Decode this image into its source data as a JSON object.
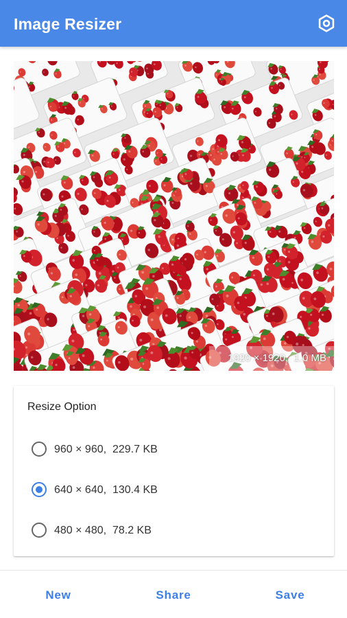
{
  "app_bar": {
    "title": "Image Resizer",
    "settings_icon": "gear-icon"
  },
  "preview": {
    "info": "1920 × 1920,  1.0 MB",
    "subject": "strawberries-in-containers"
  },
  "resize_card": {
    "title": "Resize Option",
    "options": [
      {
        "label": "960 × 960,  229.7 KB",
        "selected": false
      },
      {
        "label": "640 × 640,  130.4 KB",
        "selected": true
      },
      {
        "label": "480 × 480,  78.2 KB",
        "selected": false
      }
    ]
  },
  "actions": {
    "new_label": "New",
    "share_label": "Share",
    "save_label": "Save"
  },
  "colors": {
    "app_bar": "#4a88e8",
    "accent": "#3d7fe6",
    "berry": "#c91f2a",
    "container": "#ffffff"
  }
}
